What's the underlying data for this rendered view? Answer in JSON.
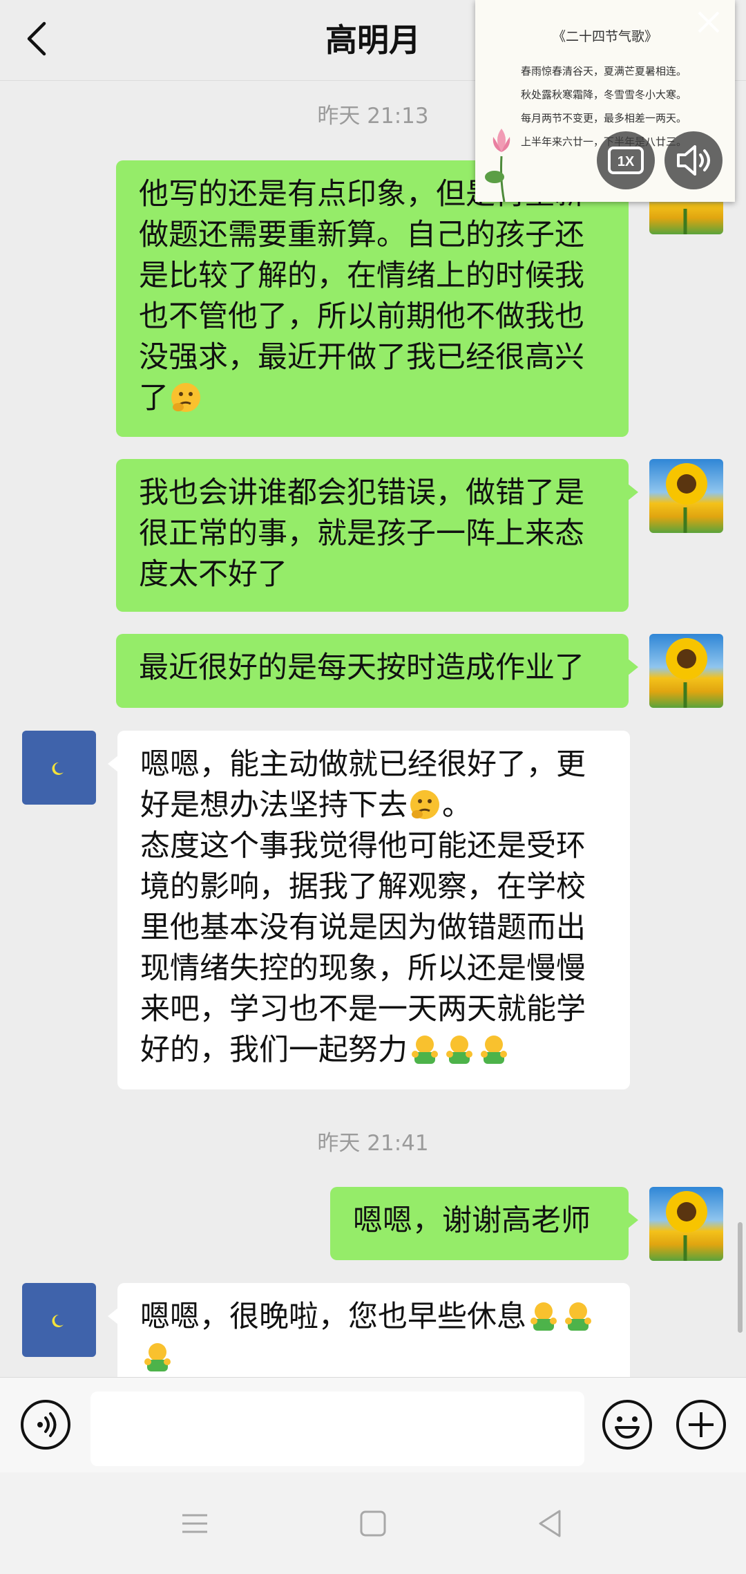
{
  "header": {
    "title": "高明月"
  },
  "times": [
    "昨天 21:13",
    "昨天 21:41"
  ],
  "messages": [
    {
      "sender": "me",
      "text": "他写的还是有点印象，但是再重新做题还需要重新算。自己的孩子还是比较了解的，在情绪上的时候我也不管他了，所以前期他不做我也没强求，最近开做了我已经很高兴了",
      "emoji": "thinking-face"
    },
    {
      "sender": "me",
      "text": "我也会讲谁都会犯错误，做错了是很正常的事，就是孩子一阵上来态度太不好了"
    },
    {
      "sender": "me",
      "text": "最近很好的是每天按时造成作业了"
    },
    {
      "sender": "other",
      "text1": "嗯嗯，能主动做就已经很好了，更好是想办法坚持下去",
      "text1_end": "。",
      "text2": "态度这个事我觉得他可能还是受环境的影响，据我了解观察，在学校里他基本没有说是因为做错题而出现情绪失控的现象，所以还是慢慢来吧，学习也不是一天两天就能学好的，我们一起努力",
      "emoji": "thinking-face",
      "trailing_emojis": [
        "fist-fighting",
        "fist-fighting",
        "fist-fighting"
      ]
    },
    {
      "sender": "me",
      "text": "嗯嗯，谢谢高老师"
    },
    {
      "sender": "other",
      "text": "嗯嗯，很晚啦，您也早些休息",
      "trailing_emojis": [
        "fist-fighting",
        "fist-fighting",
        "fist-fighting"
      ]
    }
  ],
  "floating_window": {
    "title": "《二十四节气歌》",
    "lines": [
      "春雨惊春清谷天，夏满芒夏暑相连。",
      "秋处露秋寒霜降，冬雪雪冬小大寒。",
      "每月两节不变更，最多相差一两天。",
      "上半年来六廿一，下半年是八廿三。"
    ],
    "speed_label": "1X",
    "icons": [
      "close-icon",
      "speed-icon",
      "speaker-icon"
    ]
  },
  "input_bar": {
    "placeholder": ""
  },
  "colors": {
    "my_bubble": "#95ec69",
    "other_bubble": "#ffffff",
    "background": "#ededed"
  }
}
